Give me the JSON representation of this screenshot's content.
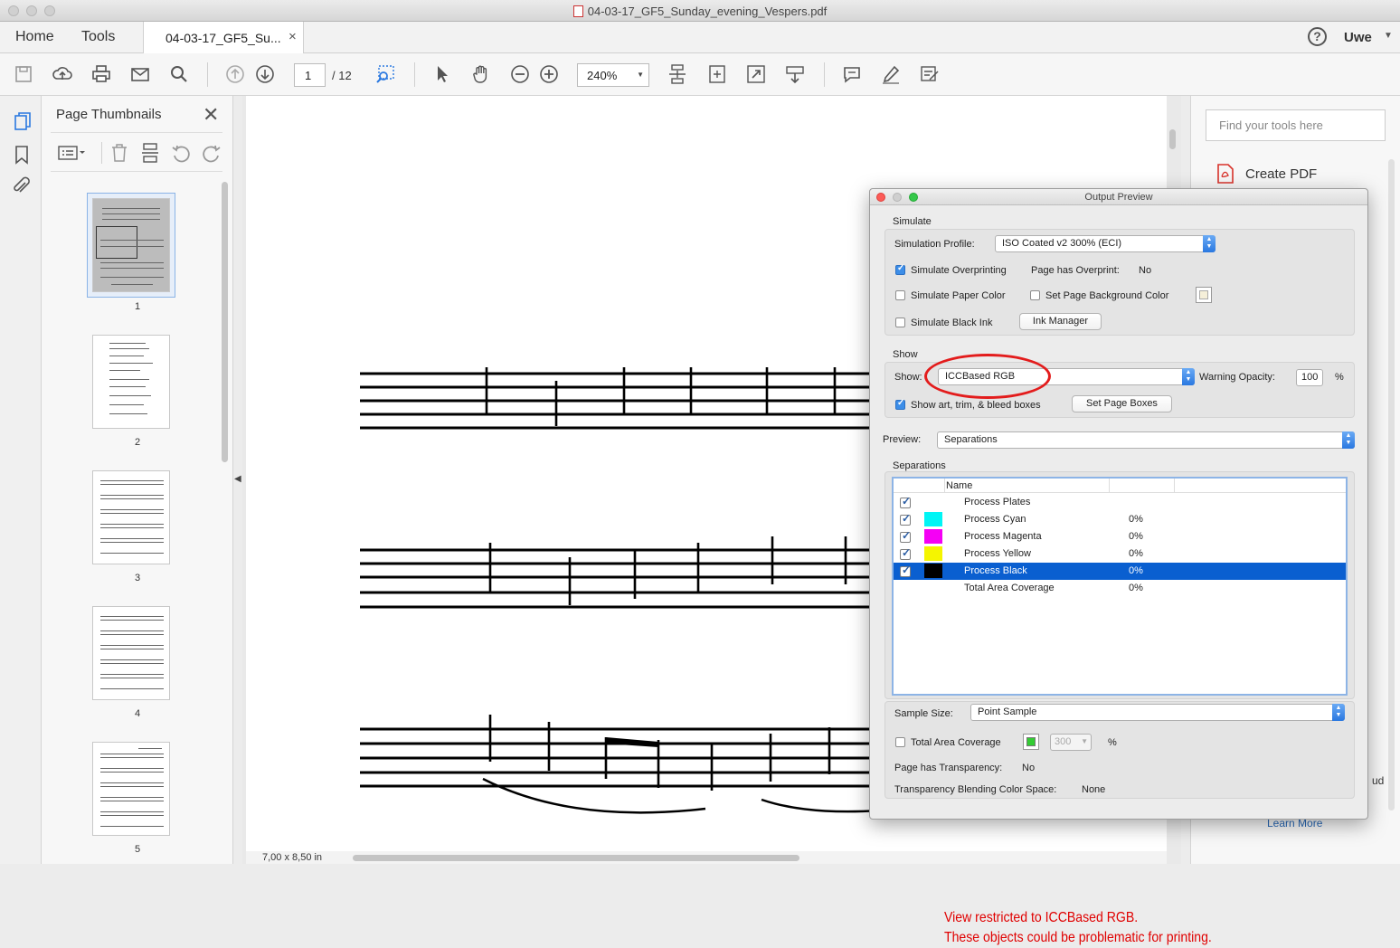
{
  "window": {
    "title": "04-03-17_GF5_Sunday_evening_Vespers.pdf"
  },
  "tabs": {
    "home": "Home",
    "tools": "Tools",
    "doc_tab": "04-03-17_GF5_Su...",
    "doc_tab_close": "×"
  },
  "user": {
    "help_glyph": "?",
    "name": "Uwe"
  },
  "toolbar": {
    "page_current": "1",
    "page_total": "/ 12",
    "zoom": "240%"
  },
  "thumbnails": {
    "title": "Page Thumbnails",
    "pages": [
      "1",
      "2",
      "3",
      "4",
      "5"
    ]
  },
  "document": {
    "page_size": "7,00 x 8,50 in"
  },
  "right_panel": {
    "search_placeholder": "Find your tools here",
    "create_pdf": "Create PDF",
    "learn_more": "Learn More",
    "cloud_fragment": "ud"
  },
  "output_preview": {
    "title": "Output Preview",
    "simulate": {
      "group_label": "Simulate",
      "profile_label": "Simulation Profile:",
      "profile_value": "ISO Coated v2 300% (ECI)",
      "overprinting_label": "Simulate Overprinting",
      "overprinting_checked": true,
      "page_overprint_label": "Page has Overprint:",
      "page_overprint_value": "No",
      "paper_color_label": "Simulate Paper Color",
      "paper_color_checked": false,
      "page_bg_label": "Set Page Background Color",
      "page_bg_checked": false,
      "black_ink_label": "Simulate Black Ink",
      "black_ink_checked": false,
      "ink_manager_button": "Ink Manager"
    },
    "show": {
      "group_label": "Show",
      "show_label": "Show:",
      "show_value": "ICCBased RGB",
      "warning_opacity_label": "Warning Opacity:",
      "warning_opacity_value": "100",
      "percent": "%",
      "boxes_label": "Show art, trim, & bleed boxes",
      "boxes_checked": true,
      "set_page_boxes_button": "Set Page Boxes"
    },
    "preview": {
      "label": "Preview:",
      "value": "Separations"
    },
    "separations": {
      "group_label": "Separations",
      "column_name": "Name",
      "rows": [
        {
          "name": "Process Plates",
          "pct": "",
          "color": "",
          "checked": true
        },
        {
          "name": "Process Cyan",
          "pct": "0%",
          "color": "#00f5f5",
          "checked": true
        },
        {
          "name": "Process Magenta",
          "pct": "0%",
          "color": "#f500f5",
          "checked": true
        },
        {
          "name": "Process Yellow",
          "pct": "0%",
          "color": "#f5f500",
          "checked": true
        },
        {
          "name": "Process Black",
          "pct": "0%",
          "color": "#000000",
          "checked": true,
          "selected": true
        },
        {
          "name": "Total Area Coverage",
          "pct": "0%",
          "color": "",
          "checked": false
        }
      ]
    },
    "annotation_line1": "View restricted to ICCBased RGB.",
    "annotation_line2": "These objects could be problematic for printing.",
    "sample_size_label": "Sample Size:",
    "sample_size_value": "Point Sample",
    "tac_label": "Total Area Coverage",
    "tac_checked": false,
    "tac_color": "#33cc33",
    "tac_value": "300",
    "tac_percent": "%",
    "transparency_label": "Page has Transparency:",
    "transparency_value": "No",
    "blending_label": "Transparency Blending Color Space:",
    "blending_value": "None"
  },
  "colors": {
    "accent": "#2a78e0",
    "selection": "#0a5fd0",
    "annotation": "#e00000"
  }
}
